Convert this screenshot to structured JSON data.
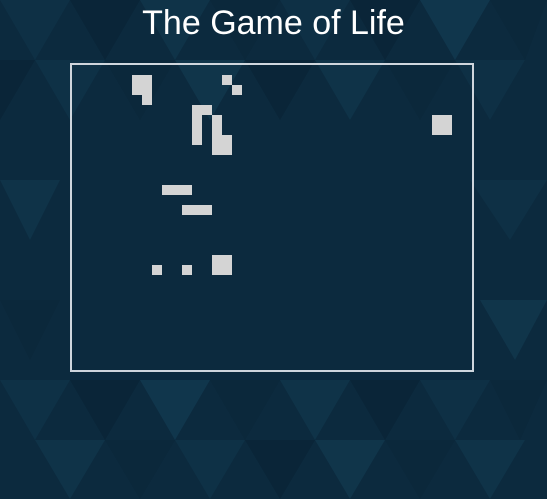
{
  "page": {
    "title": "The Game of Life"
  },
  "colors": {
    "background": "#0c2a3e",
    "cell_alive": "#d4d4d4",
    "board_border": "#cfd6dd",
    "title_text": "#ffffff"
  },
  "board": {
    "columns": 40,
    "rows": 30,
    "live_cells": [
      [
        1,
        6
      ],
      [
        1,
        7
      ],
      [
        1,
        15
      ],
      [
        2,
        6
      ],
      [
        2,
        7
      ],
      [
        2,
        16
      ],
      [
        3,
        7
      ],
      [
        4,
        12
      ],
      [
        4,
        13
      ],
      [
        5,
        12
      ],
      [
        5,
        14
      ],
      [
        5,
        36
      ],
      [
        5,
        37
      ],
      [
        6,
        12
      ],
      [
        6,
        14
      ],
      [
        6,
        36
      ],
      [
        6,
        37
      ],
      [
        7,
        12
      ],
      [
        7,
        14
      ],
      [
        7,
        15
      ],
      [
        8,
        14
      ],
      [
        8,
        15
      ],
      [
        12,
        9
      ],
      [
        12,
        10
      ],
      [
        12,
        11
      ],
      [
        14,
        11
      ],
      [
        14,
        12
      ],
      [
        14,
        13
      ],
      [
        19,
        14
      ],
      [
        19,
        15
      ],
      [
        20,
        8
      ],
      [
        20,
        11
      ],
      [
        20,
        14
      ],
      [
        20,
        15
      ]
    ]
  }
}
